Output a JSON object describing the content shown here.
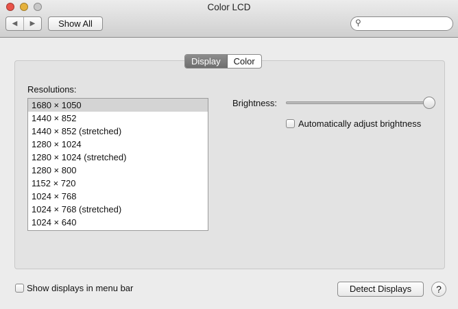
{
  "window": {
    "title": "Color LCD"
  },
  "toolbar": {
    "back": "◀",
    "forward": "▶",
    "show_all": "Show All",
    "search_placeholder": ""
  },
  "tabs": [
    {
      "label": "Display",
      "selected": true
    },
    {
      "label": "Color",
      "selected": false
    }
  ],
  "resolutions": {
    "label": "Resolutions:",
    "selected_index": 0,
    "items": [
      "1680 × 1050",
      "1440 × 852",
      "1440 × 852 (stretched)",
      "1280 × 1024",
      "1280 × 1024 (stretched)",
      "1280 × 800",
      "1152 × 720",
      "1024 × 768",
      "1024 × 768 (stretched)",
      "1024 × 640"
    ]
  },
  "brightness": {
    "label": "Brightness:",
    "value": 1.0,
    "auto_label": "Automatically adjust brightness",
    "auto_checked": false
  },
  "footer": {
    "show_menu_bar_label": "Show displays in menu bar",
    "show_menu_bar_checked": false,
    "detect_label": "Detect Displays",
    "help": "?"
  }
}
